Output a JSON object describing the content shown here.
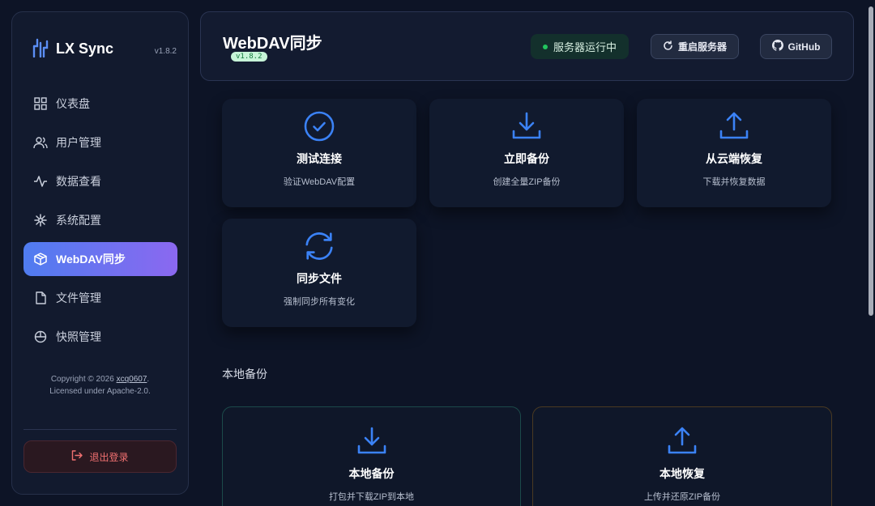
{
  "app": {
    "brand_title": "LX Sync",
    "brand_version": "v1.8.2"
  },
  "sidebar": {
    "items": [
      {
        "label": "仪表盘",
        "icon": "grid-icon",
        "active": false
      },
      {
        "label": "用户管理",
        "icon": "users-icon",
        "active": false
      },
      {
        "label": "数据查看",
        "icon": "activity-icon",
        "active": false
      },
      {
        "label": "系统配置",
        "icon": "settings-icon",
        "active": false
      },
      {
        "label": "WebDAV同步",
        "icon": "cube-icon",
        "active": true
      },
      {
        "label": "文件管理",
        "icon": "file-icon",
        "active": false
      },
      {
        "label": "快照管理",
        "icon": "snapshot-icon",
        "active": false
      }
    ],
    "footer": {
      "copyright_prefix": "Copyright © 2026 ",
      "author": "xcq0607",
      "copyright_suffix": ".",
      "license": "Licensed under Apache-2.0."
    },
    "logout_label": "退出登录"
  },
  "header": {
    "title": "WebDAV同步",
    "version_badge": "v1.8.2",
    "status_text": "服务器运行中",
    "restart_label": "重启服务器",
    "github_label": "GitHub"
  },
  "actions": [
    {
      "title": "测试连接",
      "subtitle": "验证WebDAV配置",
      "icon": "check-circle-icon"
    },
    {
      "title": "立即备份",
      "subtitle": "创建全量ZIP备份",
      "icon": "download-icon"
    },
    {
      "title": "从云端恢复",
      "subtitle": "下载并恢复数据",
      "icon": "upload-icon"
    },
    {
      "title": "同步文件",
      "subtitle": "强制同步所有变化",
      "icon": "refresh-icon"
    }
  ],
  "local_section": {
    "title": "本地备份",
    "cards": [
      {
        "title": "本地备份",
        "subtitle": "打包并下载ZIP到本地",
        "icon": "download-icon"
      },
      {
        "title": "本地恢复",
        "subtitle": "上传并还原ZIP备份",
        "icon": "upload-icon"
      }
    ]
  },
  "colors": {
    "accent_blue": "#3b82f6",
    "active_gradient_start": "#4f7cf0",
    "active_gradient_end": "#8b68f0",
    "status_green": "#22c55e",
    "logout_red": "#f07070"
  }
}
